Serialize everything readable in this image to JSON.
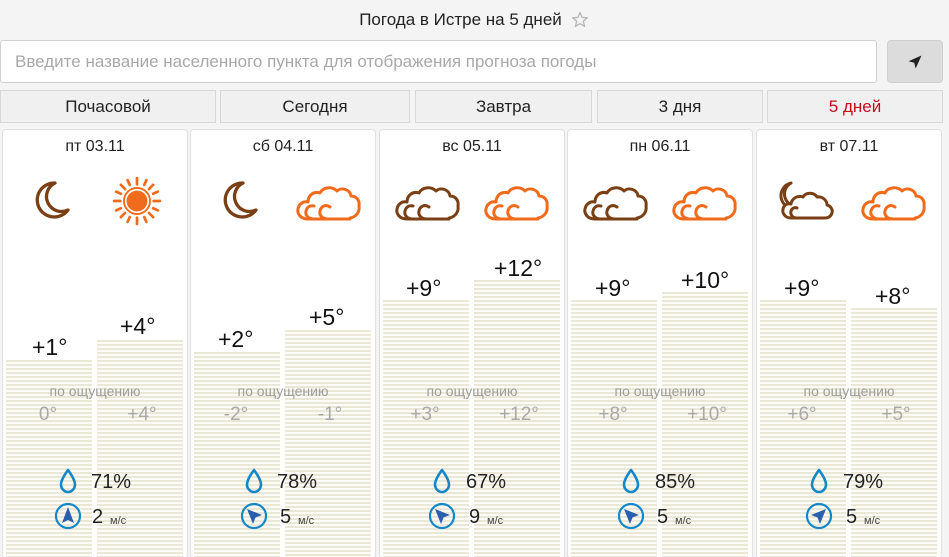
{
  "header": {
    "title": "Погода в Истре на 5 дней",
    "favorite_icon": "star-outline-icon"
  },
  "search": {
    "placeholder": "Введите название населенного пункта для отображения прогноза погоды",
    "value": "",
    "locate_icon": "location-arrow-icon"
  },
  "tabs": [
    {
      "label": "Почасовой",
      "active": false
    },
    {
      "label": "Сегодня",
      "active": false
    },
    {
      "label": "Завтра",
      "active": false
    },
    {
      "label": "3 дня",
      "active": false
    },
    {
      "label": "5 дней",
      "active": true
    }
  ],
  "feels_label": "по ощущению",
  "wind_unit": "м/с",
  "colors": {
    "accent_active": "#c30d1b",
    "icon_brown": "#7a3f14",
    "icon_orange": "#f06b1b",
    "drop_blue": "#1487c9"
  },
  "days": [
    {
      "date": "пт 03.11",
      "night_icon": "moon-icon",
      "day_icon": "sun-icon",
      "night_temp": "+1°",
      "day_temp": "+4°",
      "feels_night": "0°",
      "feels_day": "+4°",
      "humidity": "71%",
      "wind_speed": "2",
      "wind_direction": "north"
    },
    {
      "date": "сб 04.11",
      "night_icon": "moon-icon",
      "day_icon": "cloud-icon",
      "night_temp": "+2°",
      "day_temp": "+5°",
      "feels_night": "-2°",
      "feels_day": "-1°",
      "humidity": "78%",
      "wind_speed": "5",
      "wind_direction": "northwest"
    },
    {
      "date": "вс 05.11",
      "night_icon": "cloud-icon",
      "day_icon": "cloud-icon",
      "night_temp": "+9°",
      "day_temp": "+12°",
      "feels_night": "+3°",
      "feels_day": "+12°",
      "humidity": "67%",
      "wind_speed": "9",
      "wind_direction": "northwest"
    },
    {
      "date": "пн 06.11",
      "night_icon": "cloud-icon",
      "day_icon": "cloud-icon",
      "night_temp": "+9°",
      "day_temp": "+10°",
      "feels_night": "+8°",
      "feels_day": "+10°",
      "humidity": "85%",
      "wind_speed": "5",
      "wind_direction": "northwest"
    },
    {
      "date": "вт 07.11",
      "night_icon": "moon-cloud-icon",
      "day_icon": "cloud-icon",
      "night_temp": "+9°",
      "day_temp": "+8°",
      "feels_night": "+6°",
      "feels_day": "+5°",
      "humidity": "79%",
      "wind_speed": "5",
      "wind_direction": "northeast"
    }
  ]
}
